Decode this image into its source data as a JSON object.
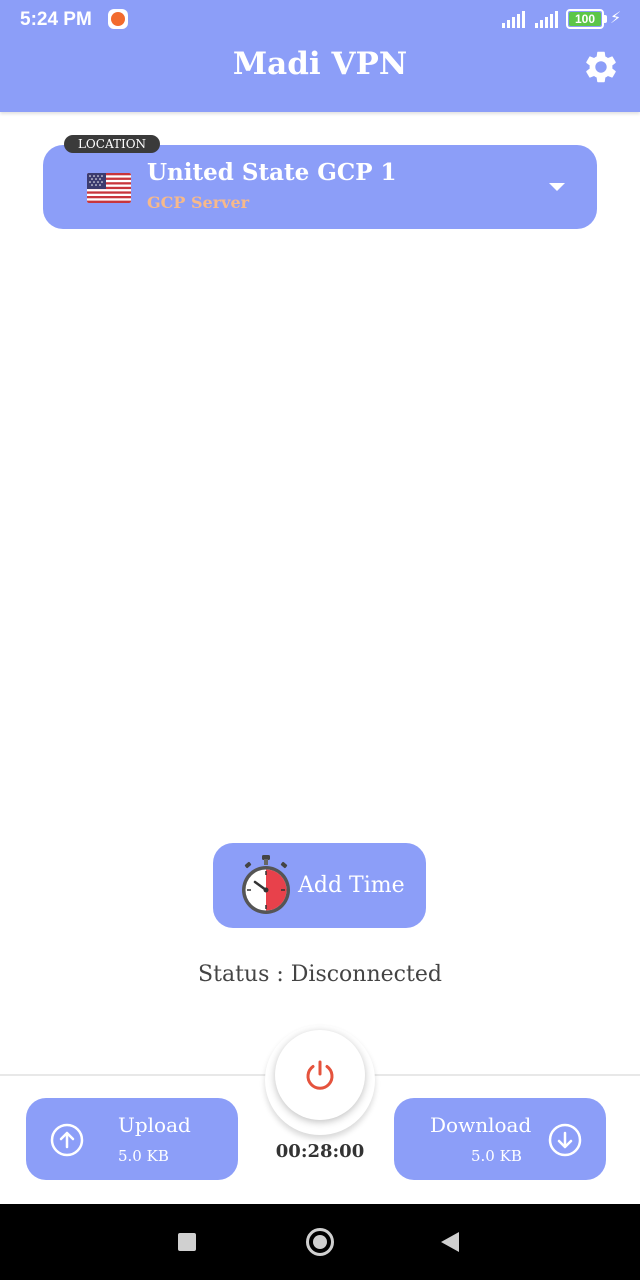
{
  "status_bar": {
    "time": "5:24 PM",
    "notification_icon": "app-notification-icon",
    "battery": "100"
  },
  "header": {
    "title": "Madi VPN",
    "settings_icon": "gear-icon"
  },
  "location": {
    "badge": "LOCATION",
    "server_name": "United State GCP 1",
    "server_type": "GCP Server",
    "flag_icon": "us-flag-icon"
  },
  "add_time": {
    "label": "Add Time",
    "icon": "stopwatch-icon"
  },
  "status": {
    "text": "Status : Disconnected"
  },
  "connection": {
    "power_icon": "power-icon",
    "timer": "00:28:00"
  },
  "upload": {
    "label": "Upload",
    "value": "5.0 KB",
    "icon": "upload-arrow-icon"
  },
  "download": {
    "label": "Download",
    "value": "5.0 KB",
    "icon": "download-arrow-icon"
  },
  "colors": {
    "primary": "#8c9ef8",
    "accent_orange": "#f7b98a",
    "power_red": "#e5533d"
  }
}
